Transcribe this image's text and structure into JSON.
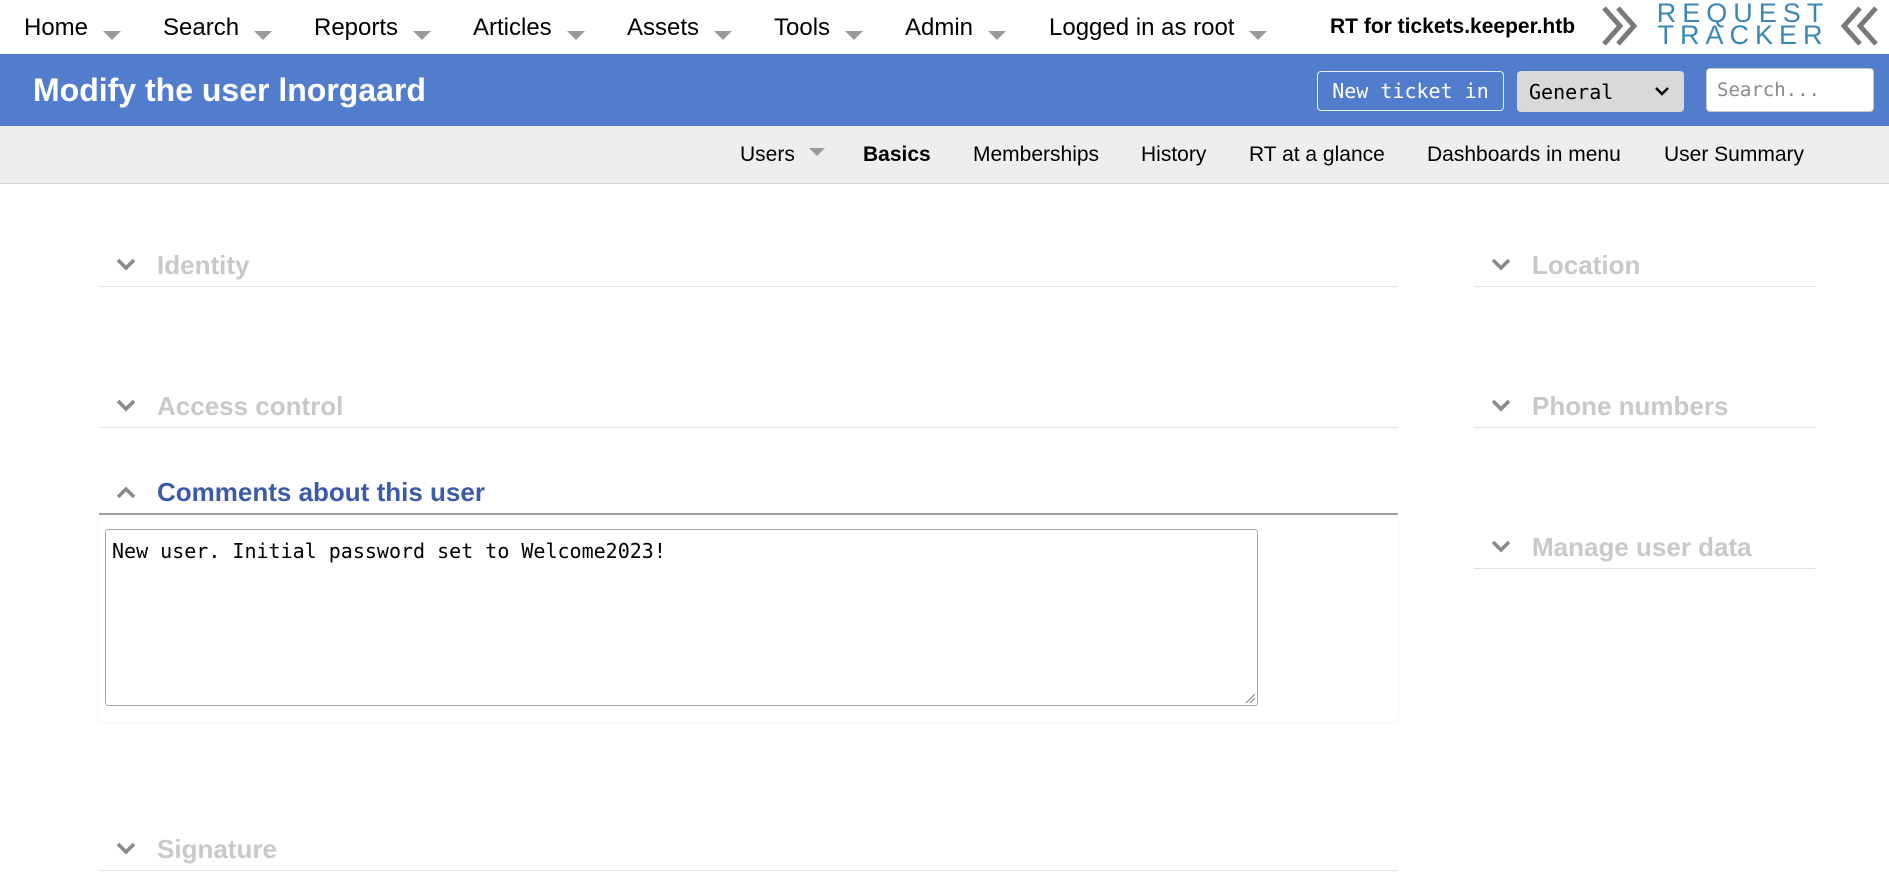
{
  "menu": {
    "items": [
      {
        "label": "Home"
      },
      {
        "label": "Search"
      },
      {
        "label": "Reports"
      },
      {
        "label": "Articles"
      },
      {
        "label": "Assets"
      },
      {
        "label": "Tools"
      },
      {
        "label": "Admin"
      },
      {
        "label": "Logged in as root"
      }
    ],
    "site_name": "RT for tickets.keeper.htb",
    "logo": {
      "line1": "REQUEST",
      "line2": "TRACKER"
    }
  },
  "header": {
    "title": "Modify the user lnorgaard",
    "new_ticket_label": "New ticket in",
    "queue_selected": "General",
    "search_placeholder": "Search..."
  },
  "subnav": {
    "items": [
      {
        "label": "Users",
        "has_menu": true
      },
      {
        "label": "Basics",
        "active": true
      },
      {
        "label": "Memberships"
      },
      {
        "label": "History"
      },
      {
        "label": "RT at a glance"
      },
      {
        "label": "Dashboards in menu"
      },
      {
        "label": "User Summary"
      }
    ]
  },
  "sections": {
    "identity": "Identity",
    "access_control": "Access control",
    "comments": "Comments about this user",
    "signature": "Signature",
    "location": "Location",
    "phone_numbers": "Phone numbers",
    "manage_user_data": "Manage user data"
  },
  "comments": {
    "value": "New user. Initial password set to Welcome2023!"
  },
  "colors": {
    "header_bg": "#527dcc",
    "open_section_title": "#3b5aa8",
    "collapsed_section_title": "#c9c9c9",
    "logo": "#3a86b8"
  }
}
